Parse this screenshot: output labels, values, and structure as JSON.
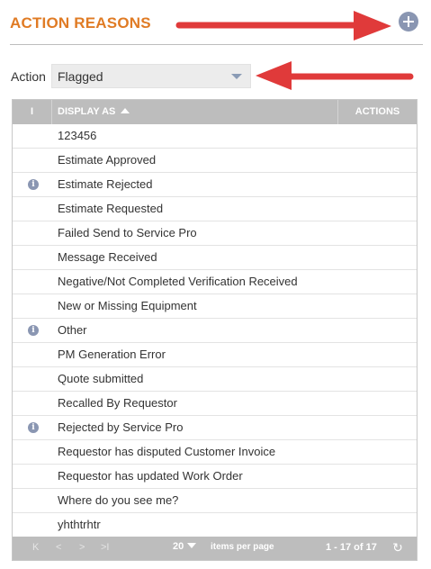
{
  "header": {
    "title": "ACTION REASONS",
    "add_icon": "plus-circle-icon"
  },
  "filter": {
    "label": "Action",
    "selected": "Flagged"
  },
  "grid": {
    "columns": {
      "info": "I",
      "display_as": "DISPLAY AS",
      "actions": "ACTIONS"
    },
    "sort": "ascending",
    "rows": [
      {
        "info": false,
        "text": "123456"
      },
      {
        "info": false,
        "text": "Estimate Approved"
      },
      {
        "info": true,
        "text": "Estimate Rejected"
      },
      {
        "info": false,
        "text": "Estimate Requested"
      },
      {
        "info": false,
        "text": "Failed Send to Service Pro"
      },
      {
        "info": false,
        "text": "Message Received"
      },
      {
        "info": false,
        "text": "Negative/Not Completed Verification Received"
      },
      {
        "info": false,
        "text": "New or Missing Equipment"
      },
      {
        "info": true,
        "text": "Other"
      },
      {
        "info": false,
        "text": "PM Generation Error"
      },
      {
        "info": false,
        "text": "Quote submitted"
      },
      {
        "info": false,
        "text": "Recalled By Requestor"
      },
      {
        "info": true,
        "text": "Rejected by Service Pro"
      },
      {
        "info": false,
        "text": "Requestor has disputed Customer Invoice"
      },
      {
        "info": false,
        "text": "Requestor has updated Work Order"
      },
      {
        "info": false,
        "text": "Where do you see me?"
      },
      {
        "info": false,
        "text": "yhthtrhtr"
      }
    ]
  },
  "pager": {
    "first": "K",
    "prev": "<",
    "next": ">",
    "last": ">I",
    "page_size": "20",
    "page_size_label": "items per page",
    "range": "1 - 17 of 17",
    "refresh_icon": "refresh-icon"
  },
  "colors": {
    "title": "#e07b24",
    "arrow": "#e03a3a",
    "icon": "#8a96b2",
    "header_bg": "#bdbdbd"
  }
}
